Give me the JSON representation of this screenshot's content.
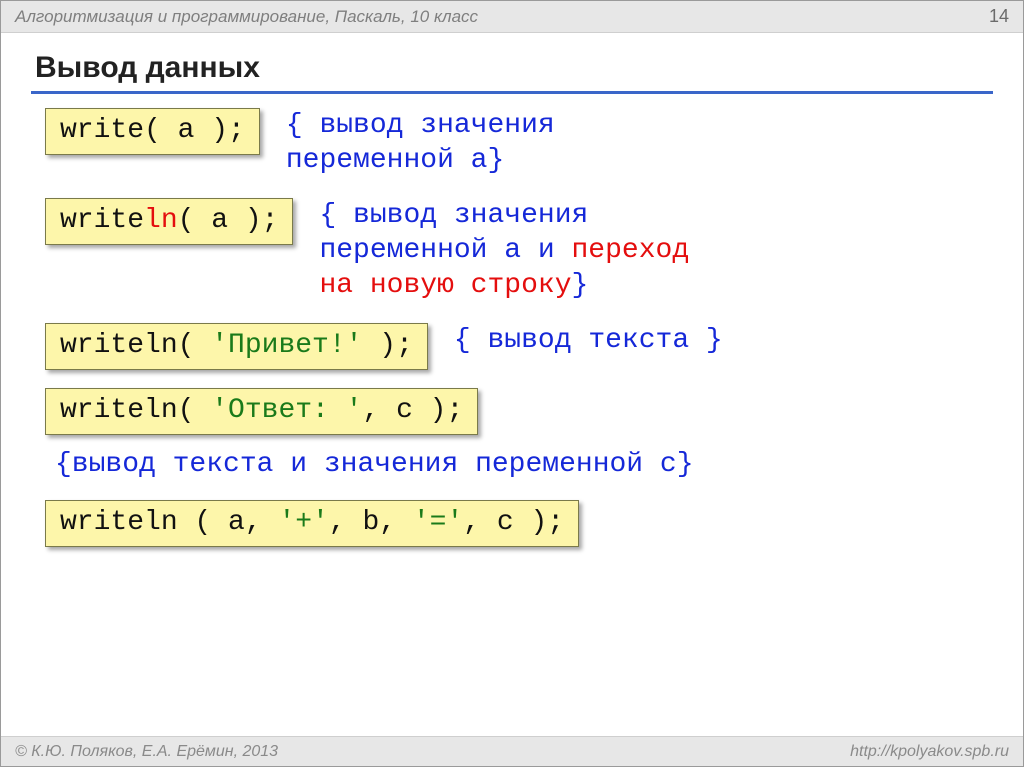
{
  "header": {
    "subject": "Алгоритмизация и программирование, Паскаль, 10 класс",
    "page": "14"
  },
  "title": "Вывод данных",
  "row1": {
    "code_full": "write( a );",
    "comment_l1": "{ вывод значения",
    "comment_l2": "  переменной a}"
  },
  "row2": {
    "code_pre": "write",
    "code_ln": "ln",
    "code_post": "( a );",
    "comment_l1": "{ вывод значения",
    "comment_l2_a": "  переменной a и ",
    "comment_l2_red": "переход",
    "comment_l3_red": "  на новую строку",
    "comment_l3_brace": "}"
  },
  "row3": {
    "code_pre": "writeln( ",
    "code_str": "'Привет!'",
    "code_post": " );",
    "comment": "{ вывод текста }"
  },
  "row4": {
    "code_pre": "writeln( ",
    "code_str": "'Ответ: '",
    "code_post": ", c );"
  },
  "row4_comment": "{вывод текста и значения переменной c}",
  "row5": {
    "code_a": "writeln ( a, ",
    "code_s1": "'+'",
    "code_b": ", b, ",
    "code_s2": "'='",
    "code_c": ", c );"
  },
  "footer": {
    "copyright": "© К.Ю. Поляков, Е.А. Ерёмин, 2013",
    "url": "http://kpolyakov.spb.ru"
  }
}
